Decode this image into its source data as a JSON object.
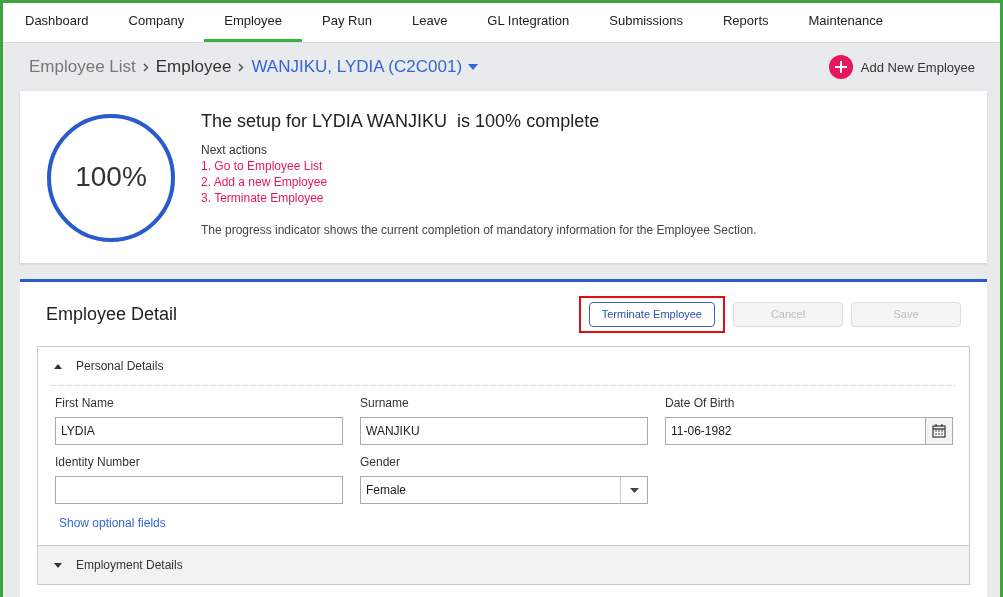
{
  "nav": [
    {
      "label": "Dashboard",
      "selected": false
    },
    {
      "label": "Company",
      "selected": false
    },
    {
      "label": "Employee",
      "selected": true
    },
    {
      "label": "Pay Run",
      "selected": false
    },
    {
      "label": "Leave",
      "selected": false
    },
    {
      "label": "GL Integration",
      "selected": false
    },
    {
      "label": "Submissions",
      "selected": false
    },
    {
      "label": "Reports",
      "selected": false
    },
    {
      "label": "Maintenance",
      "selected": false
    }
  ],
  "breadcrumb": {
    "items": [
      "Employee List",
      "Employee"
    ],
    "current": "WANJIKU, LYDIA (C2C001)"
  },
  "add_button": "Add New Employee",
  "progress": {
    "level": 1,
    "reading": "100%",
    "title": "The setup for LYDIA WANJIKU  is 100% complete",
    "next_label": "Next actions",
    "actions": [
      "1. Go to Employee List",
      "2. Add a new Employee",
      "3. Terminate Employee"
    ],
    "note": "The progress indicator shows the current completion of mandatory information for the Employee Section."
  },
  "detail": {
    "title": "Employee Detail",
    "buttons": [
      {
        "label": "Terminate Employee",
        "disabled": false,
        "highlighted": true
      },
      {
        "label": "Cancel",
        "disabled": true,
        "highlighted": false
      },
      {
        "label": "Save",
        "disabled": true,
        "highlighted": false
      }
    ],
    "sections": [
      {
        "title": "Personal Details",
        "expanded": true,
        "fields": [
          {
            "kind": "text",
            "label": "First Name",
            "value": "LYDIA"
          },
          {
            "kind": "text",
            "label": "Surname",
            "value": "WANJIKU"
          },
          {
            "kind": "date",
            "label": "Date Of Birth",
            "value": "11-06-1982"
          },
          {
            "kind": "text",
            "label": "Identity Number"
          },
          {
            "kind": "select",
            "label": "Gender",
            "value": "Female"
          }
        ],
        "link": "Show optional fields"
      },
      {
        "title": "Employment Details",
        "expanded": false
      }
    ]
  }
}
